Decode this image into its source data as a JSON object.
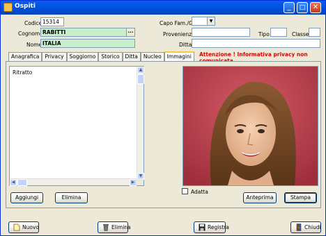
{
  "window": {
    "title": "Ospiti"
  },
  "titlebar_buttons": {
    "minimize": "_",
    "maximize": "□",
    "close": "✕"
  },
  "form": {
    "codice_label": "Codice",
    "codice_value": "15314",
    "cognome_label": "Cognome",
    "cognome_value": "RABITTI",
    "cognome_button": "...",
    "nome_label": "Nome",
    "nome_value": "ITALIA",
    "capo_label": "Capo Fam./Gr.",
    "capo_value": "",
    "provenienza_label": "Provenienza",
    "provenienza_value": "",
    "tipo_label": "Tipo",
    "tipo_value": "",
    "classe_label": "Classe",
    "classe_value": "",
    "ditta_label": "Ditta",
    "ditta_value": ""
  },
  "warning": "Attenzione ! Informativa privacy non comunicata",
  "tabs": [
    {
      "label": "Anagrafica"
    },
    {
      "label": "Privacy"
    },
    {
      "label": "Soggiorno"
    },
    {
      "label": "Storico"
    },
    {
      "label": "Ditta"
    },
    {
      "label": "Nucleo"
    },
    {
      "label": "Immagini",
      "active": true
    }
  ],
  "images": {
    "list_items": [
      "Ritratto"
    ],
    "add_button": "Aggiungi",
    "delete_button": "Elimina",
    "adapt_label": "Adatta",
    "preview_button": "Anteprima",
    "print_button": "Stampa"
  },
  "footer": {
    "new_button": "Nuovo",
    "delete_button": "Elimina",
    "save_button": "Registra",
    "close_button": "Chiudi"
  },
  "colors": {
    "title_bar": "#0054E3",
    "window_bg": "#ECE9D8",
    "required_field_bg": "#C8F0C8",
    "warning_text": "#E00000",
    "photo_bg": "#C0404E"
  },
  "icons": {
    "app": "app-folder-icon",
    "new": "new-document-icon",
    "delete": "trash-icon",
    "save": "floppy-disk-icon",
    "close": "exit-door-icon"
  }
}
